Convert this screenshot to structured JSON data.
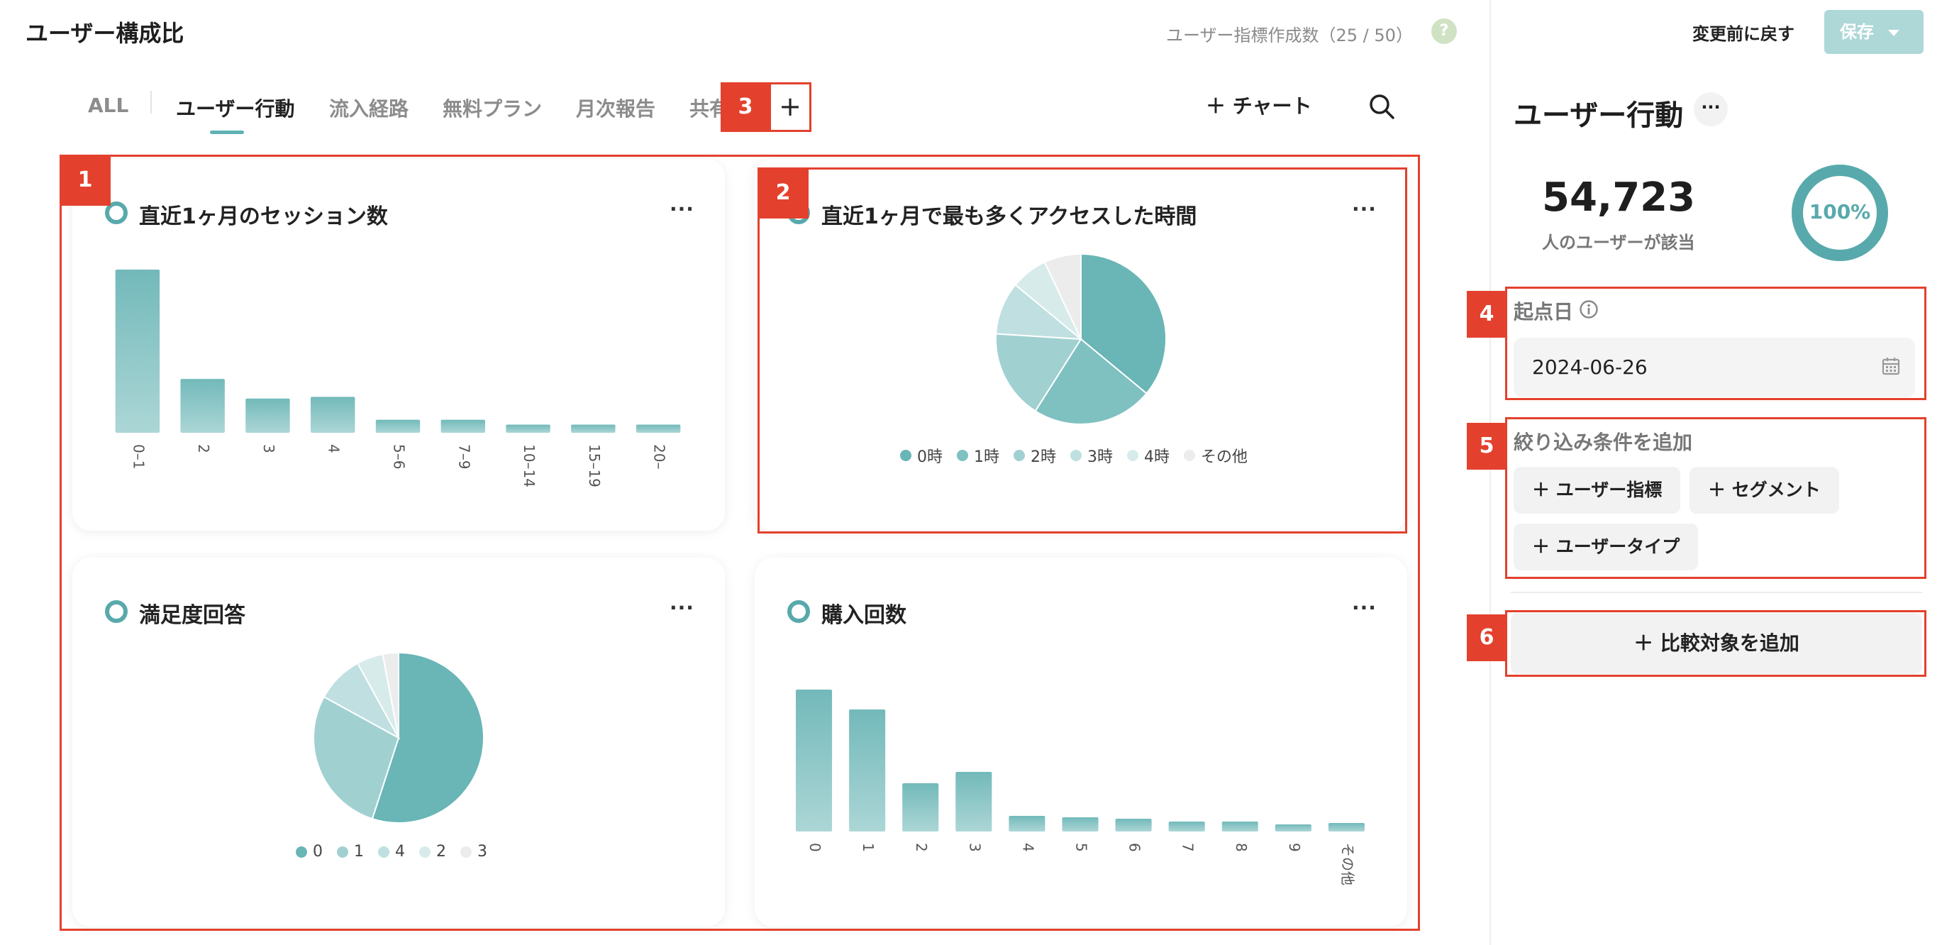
{
  "header": {
    "title": "ユーザー構成比",
    "quota": "ユーザー指標作成数（25 / 50）",
    "help": "?"
  },
  "tabs": [
    {
      "label": "ALL"
    },
    {
      "label": "ユーザー行動"
    },
    {
      "label": "流入経路"
    },
    {
      "label": "無料プラン"
    },
    {
      "label": "月次報告"
    },
    {
      "label": "共有"
    }
  ],
  "toolbar": {
    "add_tab": "+",
    "chart_button": "＋ チャート"
  },
  "markers": [
    "1",
    "2",
    "3",
    "4",
    "5",
    "6"
  ],
  "cards": {
    "sessions": {
      "title": "直近1ヶ月のセッション数",
      "menu": "···"
    },
    "access_time": {
      "title": "直近1ヶ月で最も多くアクセスした時間",
      "menu": "···"
    },
    "satisfaction": {
      "title": "満足度回答",
      "menu": "···"
    },
    "purchases": {
      "title": "購入回数",
      "menu": "···"
    }
  },
  "chart_data": [
    {
      "type": "bar",
      "title": "直近1ヶ月のセッション数",
      "categories": [
        "0–1",
        "2",
        "3",
        "4",
        "5–6",
        "7–9",
        "10–14",
        "15–19",
        "20–"
      ],
      "values": [
        100,
        33,
        21,
        22,
        8,
        8,
        5,
        5,
        5
      ],
      "color": "#7fc0c1"
    },
    {
      "type": "pie",
      "title": "直近1ヶ月で最も多くアクセスした時間",
      "categories": [
        "0時",
        "1時",
        "2時",
        "3時",
        "4時",
        "その他"
      ],
      "values": [
        36,
        23,
        17,
        10,
        7,
        7
      ],
      "colors": [
        "#6ab5b6",
        "#7fc0c1",
        "#a1d0d1",
        "#bfdfe0",
        "#d8ebeb",
        "#ececec"
      ]
    },
    {
      "type": "pie",
      "title": "満足度回答",
      "categories": [
        "0",
        "1",
        "4",
        "2",
        "3"
      ],
      "values": [
        55,
        28,
        9,
        5,
        3
      ],
      "colors": [
        "#6ab5b6",
        "#a1d0d1",
        "#bfdfe0",
        "#d8ebeb",
        "#ececec"
      ]
    },
    {
      "type": "bar",
      "title": "購入回数",
      "categories": [
        "0",
        "1",
        "2",
        "3",
        "4",
        "5",
        "6",
        "7",
        "8",
        "9",
        "その他"
      ],
      "values": [
        100,
        86,
        34,
        42,
        11,
        10,
        9,
        7,
        7,
        5,
        6
      ],
      "color": "#7fc0c1"
    }
  ],
  "panel": {
    "revert": "変更前に戻す",
    "save": "保存",
    "title": "ユーザー行動",
    "menu": "···",
    "user_count": "54,723",
    "user_count_label": "人のユーザーが該当",
    "coverage": "100%",
    "coverage_value": 1.0,
    "start_date_label": "起点日",
    "start_date_value": "2024-06-26",
    "filter_label": "絞り込み条件を追加",
    "chips": [
      "＋ ユーザー指標",
      "＋ セグメント",
      "＋ ユーザータイプ"
    ],
    "compare": "＋ 比較対象を追加"
  }
}
